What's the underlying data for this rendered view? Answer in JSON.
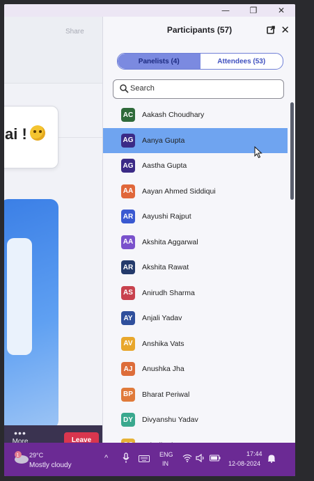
{
  "titlebar": {
    "minimize": "—",
    "maximize": "❐",
    "close": "✕"
  },
  "meeting": {
    "share_hint": "Share",
    "bubble_text": "ai !",
    "more_label": "More",
    "more_dots": "•••",
    "leave_label": "Leave"
  },
  "panel": {
    "title": "Participants (57)",
    "close": "✕",
    "tabs": {
      "panelists": "Panelists (4)",
      "attendees": "Attendees (53)"
    },
    "search_placeholder": "Search"
  },
  "participants": [
    {
      "initials": "AC",
      "name": "Aakash Choudhary",
      "color": "#2f6a3a"
    },
    {
      "initials": "AG",
      "name": "Aanya Gupta",
      "color": "#3b2a86",
      "highlight": true
    },
    {
      "initials": "AG",
      "name": "Aastha Gupta",
      "color": "#3b2a86"
    },
    {
      "initials": "AA",
      "name": "Aayan Ahmed Siddiqui",
      "color": "#e0673a"
    },
    {
      "initials": "AR",
      "name": "Aayushi Rajput",
      "color": "#3a59d1"
    },
    {
      "initials": "AA",
      "name": "Akshita Aggarwal",
      "color": "#7a52cc"
    },
    {
      "initials": "AR",
      "name": "Akshita Rawat",
      "color": "#243a6b"
    },
    {
      "initials": "AS",
      "name": "Anirudh Sharma",
      "color": "#c8424e"
    },
    {
      "initials": "AY",
      "name": "Anjali Yadav",
      "color": "#2f4f9c"
    },
    {
      "initials": "AV",
      "name": "Anshika Vats",
      "color": "#e8a72c"
    },
    {
      "initials": "AJ",
      "name": "Anushka Jha",
      "color": "#dd6d3a"
    },
    {
      "initials": "BP",
      "name": "Bharat Periwal",
      "color": "#e07a3a"
    },
    {
      "initials": "DY",
      "name": "Divyanshu Yadav",
      "color": "#3aa88e"
    },
    {
      "initials": "GS",
      "name": "Gritwik Sharma",
      "color": "#e6b236"
    }
  ],
  "taskbar": {
    "temperature": "29°C",
    "weather": "Mostly cloudy",
    "weather_badge": "1",
    "chevron": "^",
    "lang_line1": "ENG",
    "lang_line2": "IN",
    "time": "17:44",
    "date": "12-08-2024"
  }
}
